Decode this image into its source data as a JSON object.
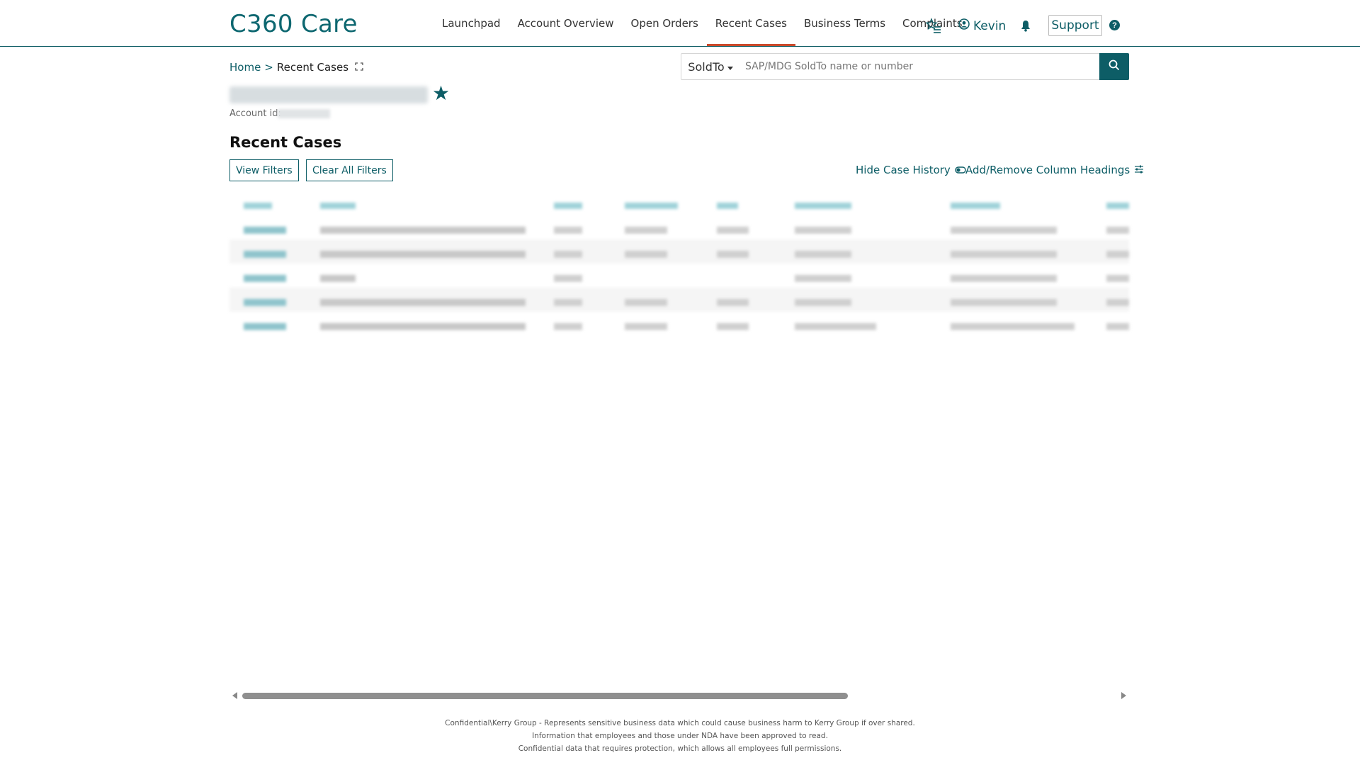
{
  "app": {
    "title": "C360 Care"
  },
  "nav": {
    "items": [
      {
        "label": "Launchpad",
        "active": false
      },
      {
        "label": "Account Overview",
        "active": false
      },
      {
        "label": "Open Orders",
        "active": false
      },
      {
        "label": "Recent Cases",
        "active": true
      },
      {
        "label": "Business Terms",
        "active": false
      },
      {
        "label": "Complaints",
        "active": false
      }
    ]
  },
  "header": {
    "favorites_icon": "star-list-icon",
    "user_icon": "user-circle-icon",
    "user_name": "Kevin",
    "notification_icon": "bell-icon",
    "support_label": "Support",
    "help_icon": "question-circle-icon",
    "help_glyph": "?"
  },
  "breadcrumb": {
    "home": "Home",
    "separator": ">",
    "current": "Recent Cases",
    "expand_icon": "expand-icon"
  },
  "search": {
    "scope_label": "SoldTo",
    "placeholder": "SAP/MDG SoldTo name or number",
    "value": "",
    "button_icon": "search-icon"
  },
  "account": {
    "id_label": "Account id:"
  },
  "page": {
    "section_title": "Recent Cases",
    "view_filters_label": "View Filters",
    "clear_filters_label": "Clear All Filters",
    "hide_history_label": "Hide Case History",
    "toggle_icon": "toggle-icon",
    "column_headings_label": "Add/Remove Column Headings",
    "column_headings_icon": "sliders-icon"
  },
  "footer": {
    "line1": "Confidential\\Kerry Group - Represents sensitive business data which could cause business harm to Kerry Group if over shared.",
    "line2": "Information that employees and those under NDA have been approved to read.",
    "line3": "Confidential data that requires protection, which allows all employees full permissions."
  },
  "colors": {
    "brand": "#0d5d66",
    "active_tab": "#c9492b",
    "link": "#1b7f8c"
  }
}
